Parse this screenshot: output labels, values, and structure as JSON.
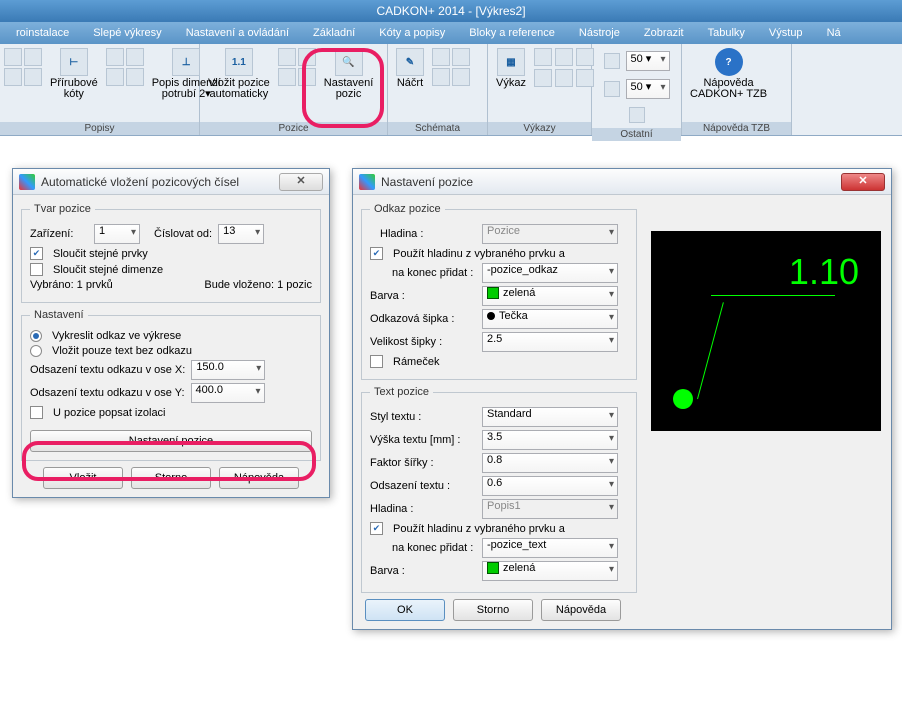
{
  "app_title": "CADKON+ 2014 - [Výkres2]",
  "menu": [
    "roinstalace",
    "Slepé výkresy",
    "Nastavení a ovládání",
    "Základní",
    "Kóty a popisy",
    "Bloky a reference",
    "Nástroje",
    "Zobrazit",
    "Tabulky",
    "Výstup",
    "Ná"
  ],
  "ribbon": {
    "popisy": {
      "label": "Popisy",
      "btn1": "Přírubové\nkóty",
      "btn2": "Popis dimenzí\npotrubí 2▾"
    },
    "pozice": {
      "label": "Pozice",
      "btn1": "Vložit pozice\nautomaticky",
      "btn2": "Nastavení\npozic",
      "ic": "1.1"
    },
    "schemata": {
      "label": "Schémata",
      "btn": "Náčrt"
    },
    "vykazy": {
      "label": "Výkazy",
      "btn": "Výkaz"
    },
    "ostatni": {
      "label": "Ostatní",
      "val": "50 ▾"
    },
    "napoveda": {
      "label": "Nápověda TZB",
      "btn": "Nápověda\nCADKON+ TZB"
    }
  },
  "dlg1": {
    "title": "Automatické vložení pozicových čísel",
    "tvar_legend": "Tvar pozice",
    "zarizeni_lab": "Zařízení:",
    "zarizeni_val": "1",
    "cislovat_lab": "Číslovat od:",
    "cislovat_val": "13",
    "slp": "Sloučit stejné prvky",
    "sld": "Sloučit stejné dimenze",
    "vybrano": "Vybráno: 1 prvků",
    "bude": "Bude vloženo: 1 pozic",
    "nast_legend": "Nastavení",
    "r1": "Vykreslit odkaz ve výkrese",
    "r2": "Vložit pouze text bez odkazu",
    "offx": "Odsazení textu odkazu v ose X:",
    "offx_v": "150.0",
    "offy": "Odsazení textu odkazu v ose Y:",
    "offy_v": "400.0",
    "upi": "U pozice popsat izolaci",
    "nast_btn": "Nastavení pozice",
    "vlozit": "Vložit",
    "storno": "Storno",
    "napoveda": "Nápověda"
  },
  "dlg2": {
    "title": "Nastavení pozice",
    "odkaz_legend": "Odkaz pozice",
    "hladina": "Hladina :",
    "hladina_v": "Pozice",
    "pouzit": "Použít hladinu z vybraného prvku a",
    "nakonec": "na konec přidat :",
    "nakonec_v": "-pozice_odkaz",
    "barva": "Barva :",
    "barva_v": "zelená",
    "sipka": "Odkazová šipka :",
    "sipka_v": "Tečka",
    "velikost": "Velikost šipky :",
    "velikost_v": "2.5",
    "ramecek": "Rámeček",
    "text_legend": "Text pozice",
    "styl": "Styl textu :",
    "styl_v": "Standard",
    "vyska": "Výška textu [mm] :",
    "vyska_v": "3.5",
    "faktor": "Faktor šířky :",
    "faktor_v": "0.8",
    "ods": "Odsazení textu :",
    "ods_v": "0.6",
    "hlad2": "Hladina :",
    "hlad2_v": "Popis1",
    "nakonec2_v": "-pozice_text",
    "ok": "OK",
    "storno": "Storno",
    "nap": "Nápověda",
    "preview_text": "1.10"
  }
}
